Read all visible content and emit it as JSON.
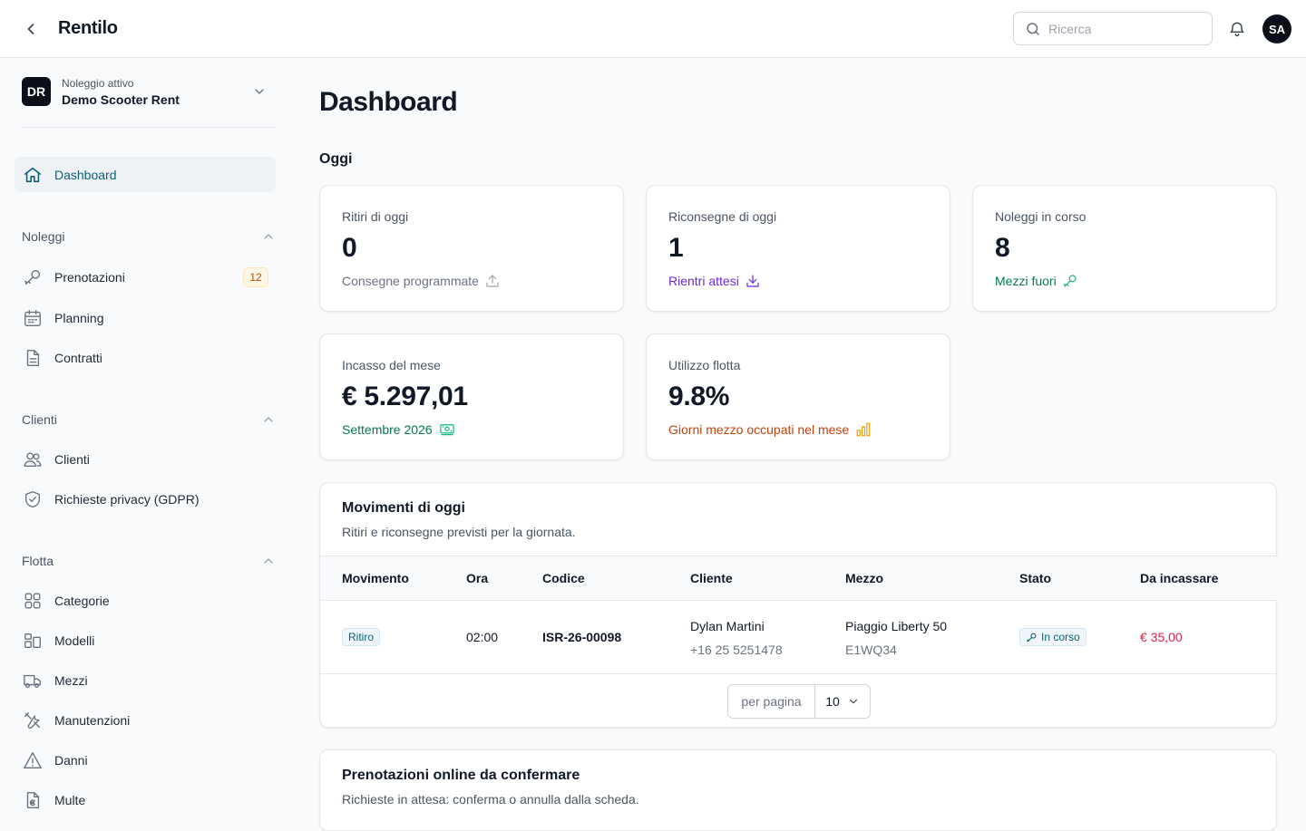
{
  "header": {
    "title": "Rentilo",
    "search_placeholder": "Ricerca",
    "avatar_initials": "SA"
  },
  "sidebar": {
    "org": {
      "logo_initials": "DR",
      "subtitle": "Noleggio attivo",
      "name": "Demo Scooter Rent"
    },
    "active_item": {
      "label": "Dashboard",
      "icon": "home-icon"
    },
    "sections": [
      {
        "title": "Noleggi",
        "items": [
          {
            "label": "Prenotazioni",
            "icon": "key-icon",
            "badge": "12"
          },
          {
            "label": "Planning",
            "icon": "calendar-icon"
          },
          {
            "label": "Contratti",
            "icon": "document-icon"
          }
        ]
      },
      {
        "title": "Clienti",
        "items": [
          {
            "label": "Clienti",
            "icon": "users-icon"
          },
          {
            "label": "Richieste privacy (GDPR)",
            "icon": "shield-check-icon"
          }
        ]
      },
      {
        "title": "Flotta",
        "items": [
          {
            "label": "Categorie",
            "icon": "grid-icon"
          },
          {
            "label": "Modelli",
            "icon": "squares-icon"
          },
          {
            "label": "Mezzi",
            "icon": "truck-icon"
          },
          {
            "label": "Manutenzioni",
            "icon": "wrench-icon"
          },
          {
            "label": "Danni",
            "icon": "warning-icon"
          },
          {
            "label": "Multe",
            "icon": "euro-document-icon"
          }
        ]
      }
    ]
  },
  "main": {
    "title": "Dashboard",
    "section_title": "Oggi",
    "stats": [
      {
        "label": "Ritiri di oggi",
        "value": "0",
        "sub": "Consegne programmate",
        "sub_color": "#6b7280",
        "icon": "upload-icon"
      },
      {
        "label": "Riconsegne di oggi",
        "value": "1",
        "sub": "Rientri attesi",
        "sub_color": "#6d28d9",
        "icon": "download-icon"
      },
      {
        "label": "Noleggi in corso",
        "value": "8",
        "sub": "Mezzi fuori",
        "sub_color": "#047857",
        "icon": "key-icon"
      },
      {
        "label": "Incasso del mese",
        "value": "€ 5.297,01",
        "sub": "Settembre 2026",
        "sub_color": "#047857",
        "icon": "cash-icon"
      },
      {
        "label": "Utilizzo flotta",
        "value": "9.8%",
        "sub": "Giorni mezzo occupati nel mese",
        "sub_color": "#c2410c",
        "icon": "bar-chart-icon"
      }
    ],
    "movements": {
      "title": "Movimenti di oggi",
      "subtitle": "Ritiri e riconsegne previsti per la giornata.",
      "columns": [
        "Movimento",
        "Ora",
        "Codice",
        "Cliente",
        "Mezzo",
        "Stato",
        "Da incassare"
      ],
      "rows": [
        {
          "movimento": "Ritiro",
          "ora": "02:00",
          "codice": "ISR-26-00098",
          "cliente_nome": "Dylan Martini",
          "cliente_tel": "+16 25 5251478",
          "mezzo_nome": "Piaggio Liberty 50",
          "mezzo_targa": "E1WQ34",
          "stato": "In corso",
          "da_incassare": "€ 35,00"
        }
      ],
      "pager": {
        "label": "per pagina",
        "value": "10"
      }
    },
    "online": {
      "title": "Prenotazioni online da confermare",
      "subtitle": "Richieste in attesa: conferma o annulla dalla scheda."
    }
  },
  "colors": {
    "accent": "#0e5f78",
    "amount": "#e11d48"
  }
}
